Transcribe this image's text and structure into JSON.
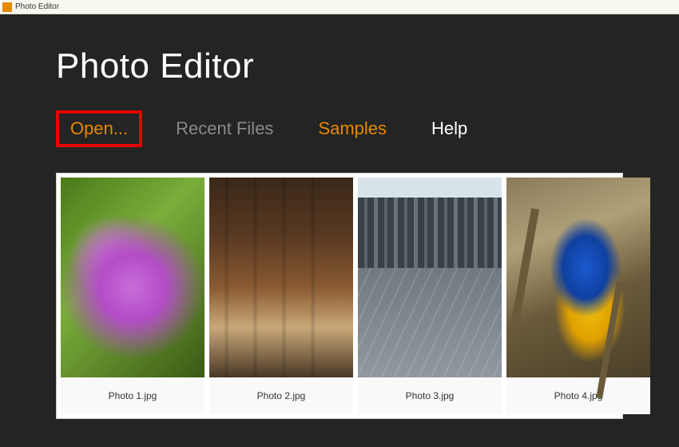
{
  "window": {
    "title": "Photo Editor"
  },
  "app": {
    "title": "Photo Editor"
  },
  "nav": {
    "open": "Open...",
    "recent": "Recent Files",
    "samples": "Samples",
    "help": "Help"
  },
  "thumbnails": [
    {
      "caption": "Photo 1.jpg"
    },
    {
      "caption": "Photo 2.jpg"
    },
    {
      "caption": "Photo 3.jpg"
    },
    {
      "caption": "Photo 4.jpg"
    }
  ],
  "colors": {
    "accent": "#e68a00",
    "highlight_border": "#e60000",
    "background": "#242424"
  }
}
